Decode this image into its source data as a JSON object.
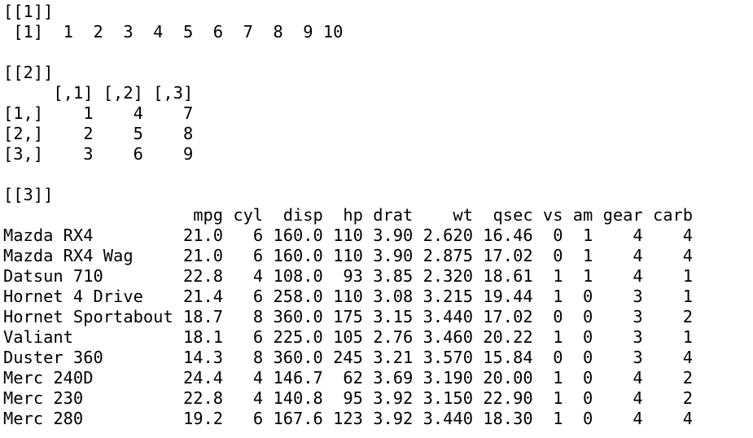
{
  "console": {
    "lines": [
      "[[1]]",
      " [1]  1  2  3  4  5  6  7  8  9 10",
      "",
      "[[2]]",
      "     [,1] [,2] [,3]",
      "[1,]    1    4    7",
      "[2,]    2    5    8",
      "[3,]    3    6    9",
      "",
      "[[3]]",
      "                   mpg cyl  disp  hp drat    wt  qsec vs am gear carb",
      "Mazda RX4         21.0   6 160.0 110 3.90 2.620 16.46  0  1    4    4",
      "Mazda RX4 Wag     21.0   6 160.0 110 3.90 2.875 17.02  0  1    4    4",
      "Datsun 710        22.8   4 108.0  93 3.85 2.320 18.61  1  1    4    1",
      "Hornet 4 Drive    21.4   6 258.0 110 3.08 3.215 19.44  1  0    3    1",
      "Hornet Sportabout 18.7   8 360.0 175 3.15 3.440 17.02  0  0    3    2",
      "Valiant           18.1   6 225.0 105 2.76 3.460 20.22  1  0    3    1",
      "Duster 360        14.3   8 360.0 245 3.21 3.570 15.84  0  0    3    4",
      "Merc 240D         24.4   4 146.7  62 3.69 3.190 20.00  1  0    4    2",
      "Merc 230          22.8   4 140.8  95 3.92 3.150 22.90  1  0    4    2",
      "Merc 280          19.2   6 167.6 123 3.92 3.440 18.30  1  0    4    4"
    ]
  }
}
